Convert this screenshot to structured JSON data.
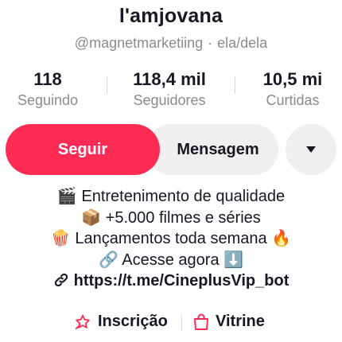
{
  "profile": {
    "display_name": "l'amjovana",
    "handle": "@magnetmarketiing",
    "separator": "·",
    "pronouns": "ela/dela"
  },
  "stats": [
    {
      "value": "118",
      "label": "Seguindo"
    },
    {
      "value": "118,4 mil",
      "label": "Seguidores"
    },
    {
      "value": "10,5 mi",
      "label": "Curtidas"
    }
  ],
  "actions": {
    "follow_label": "Seguir",
    "message_label": "Mensagem",
    "more_icon": "caret-down-icon"
  },
  "bio": {
    "line1": "🎬 Entretenimento de qualidade",
    "line2": "📦 +5.000 filmes e séries",
    "line3": "🍿 Lançamentos toda semana 🔥",
    "line4": "🔗 Acesse agora ⬇️",
    "link": "https://t.me/CineplusVip_bot",
    "link_icon": "link-icon"
  },
  "tabs": [
    {
      "label": "Inscrição",
      "icon": "subscription-icon"
    },
    {
      "label": "Vitrine",
      "icon": "shopping-bag-icon"
    }
  ],
  "colors": {
    "accent": "#fe2c55",
    "text": "#161823",
    "muted": "#8a8b91",
    "button_gray": "#efeff0"
  }
}
